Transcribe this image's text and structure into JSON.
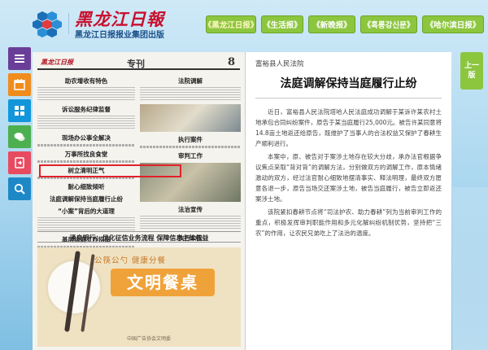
{
  "header": {
    "logo_title": "黑龙江日報",
    "logo_subtitle": "黑龙江日报报业集团出版",
    "nav": [
      {
        "label": "《黑龙江日报》",
        "active": true
      },
      {
        "label": "《生活报》"
      },
      {
        "label": "《新晚报》"
      },
      {
        "label": "《흑룡강신문》"
      },
      {
        "label": "《哈尔滨日报》"
      }
    ]
  },
  "toolbar": {
    "icons": [
      "menu-icon",
      "calendar-icon",
      "grid-icon",
      "chat-icon",
      "share-icon",
      "search-icon"
    ]
  },
  "newspaper": {
    "masthead": "黑龙江日报",
    "section": "专刊",
    "page_number": "8",
    "headlines_left": [
      "助农增收有特色",
      "诉讼服务纪律监督",
      "现场办公事全解决",
      "万事所找良食堂",
      "树立清明正气",
      "耐心细致倾听",
      "法庭调解保持当庭履行止纷",
      "“小案”背后的大道理",
      "基层法庭工作指南"
    ],
    "headlines_right": [
      "法院调解",
      "执行案件",
      "审判工作",
      "法治宣传",
      "执行公告"
    ],
    "banner": "涌泉银行：优化征信业务流程 保障信息主体权益",
    "ad_slogan": "公筷公勺 健康分餐",
    "ad_title": "文明餐桌",
    "ad_footer": "中国广告协会文明委"
  },
  "article": {
    "source": "富裕县人民法院",
    "title": "法庭调解保持当庭履行止纷",
    "paragraphs": [
      "近日，富裕县人民法院塔哈人民法庭成功调解于某诉许某农村土地承包合同纠纷案件，原告于某当庭履行25,000元。被告许某同意将14.8亩土地返还给原告，既维护了当事人的合法权益又保护了春耕生产顺利进行。",
      "本案中，原、被告对于案涉土地存在较大分歧，承办法官根据争议焦点采取“背对背”的调解方法，分别做双方的调解工作，原本情绪激动的双方，经过法官耐心细致地摆清事实、释法明理，最终双方愿意各退一步，原告当场交还案涉土地，被告当庭履行，被告立即返还案涉土地。",
      "该院紧扣春耕节点将“司法护农、助力春耕”列为当前审判工作的重点，积极发挥审判职能作用和多元化解纠纷机制优势，坚持把“三农”的作用，让农民兄弟吃上了法治的温度。"
    ]
  },
  "page_tab": {
    "line1": "上一",
    "line2": "版"
  }
}
